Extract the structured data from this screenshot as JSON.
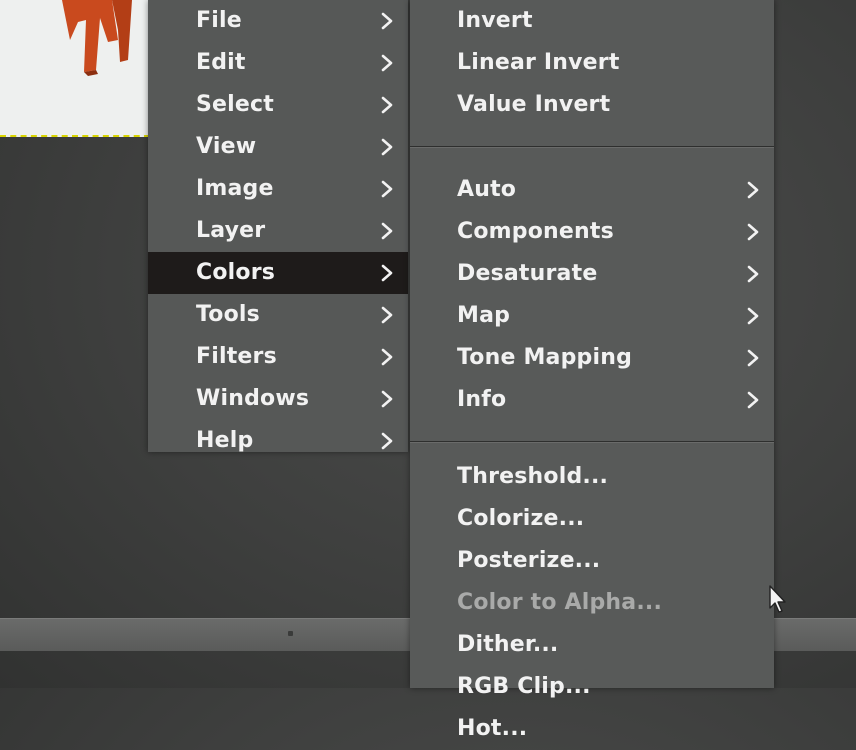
{
  "main_menu": {
    "items": [
      {
        "label": "File"
      },
      {
        "label": "Edit"
      },
      {
        "label": "Select"
      },
      {
        "label": "View"
      },
      {
        "label": "Image"
      },
      {
        "label": "Layer"
      },
      {
        "label": "Colors",
        "active": true
      },
      {
        "label": "Tools"
      },
      {
        "label": "Filters"
      },
      {
        "label": "Windows"
      },
      {
        "label": "Help"
      }
    ]
  },
  "colors_submenu": {
    "group1": [
      {
        "label": "Invert"
      },
      {
        "label": "Linear Invert"
      },
      {
        "label": "Value Invert"
      }
    ],
    "group2": [
      {
        "label": "Auto"
      },
      {
        "label": "Components"
      },
      {
        "label": "Desaturate"
      },
      {
        "label": "Map"
      },
      {
        "label": "Tone Mapping"
      },
      {
        "label": "Info"
      }
    ],
    "group3": [
      {
        "label": "Threshold..."
      },
      {
        "label": "Colorize..."
      },
      {
        "label": "Posterize..."
      },
      {
        "label": "Color to Alpha...",
        "disabled": true
      },
      {
        "label": "Dither..."
      },
      {
        "label": "RGB Clip..."
      },
      {
        "label": "Hot..."
      }
    ]
  },
  "icons": {
    "submenu_arrow": "chevron-right-icon",
    "pointer": "mouse-cursor-icon"
  },
  "colors": {
    "menu_bg": "#565857",
    "active_bg": "#1e1b1a",
    "text": "#f2f2f2",
    "disabled_text": "#a9aaa9"
  }
}
